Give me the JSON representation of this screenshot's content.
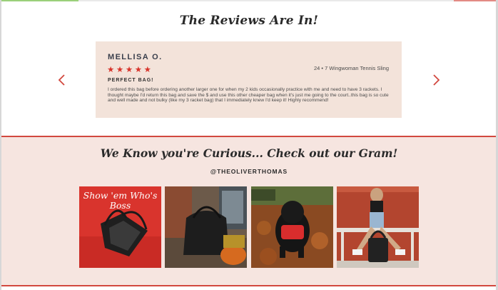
{
  "reviews": {
    "title": "The Reviews Are In!",
    "card": {
      "name": "MELLISA O.",
      "stars": "★★★★★",
      "product": "24 • 7 Wingwoman Tennis Sling",
      "headline": "PERFECT BAG!",
      "body": "I ordered this bag before ordering another larger one for when my 2 kids occasionally practice with me and need to have 3 rackets. I thought maybe I'd return this bag and save the $ and use this other cheaper bag when it's just me going to the court..this bag is so cute and well made and not bulky (like my 3 racket bag) that I immediately knew I'd keep it! Highly recommend!"
    },
    "prev_icon": "chevron-left-icon",
    "next_icon": "chevron-right-icon"
  },
  "gram": {
    "title": "We Know you're Curious... Check out our Gram!",
    "handle": "@THEOLIVERTHOMAS",
    "photos": [
      {
        "overlay": "Show 'em Who's Boss"
      },
      {
        "overlay": ""
      },
      {
        "overlay": ""
      },
      {
        "overlay": ""
      }
    ]
  },
  "colors": {
    "accent_red": "#d2483f",
    "card_bg": "#f3e3da",
    "section_bg": "#f6e5e0",
    "star_red": "#d8342b"
  }
}
